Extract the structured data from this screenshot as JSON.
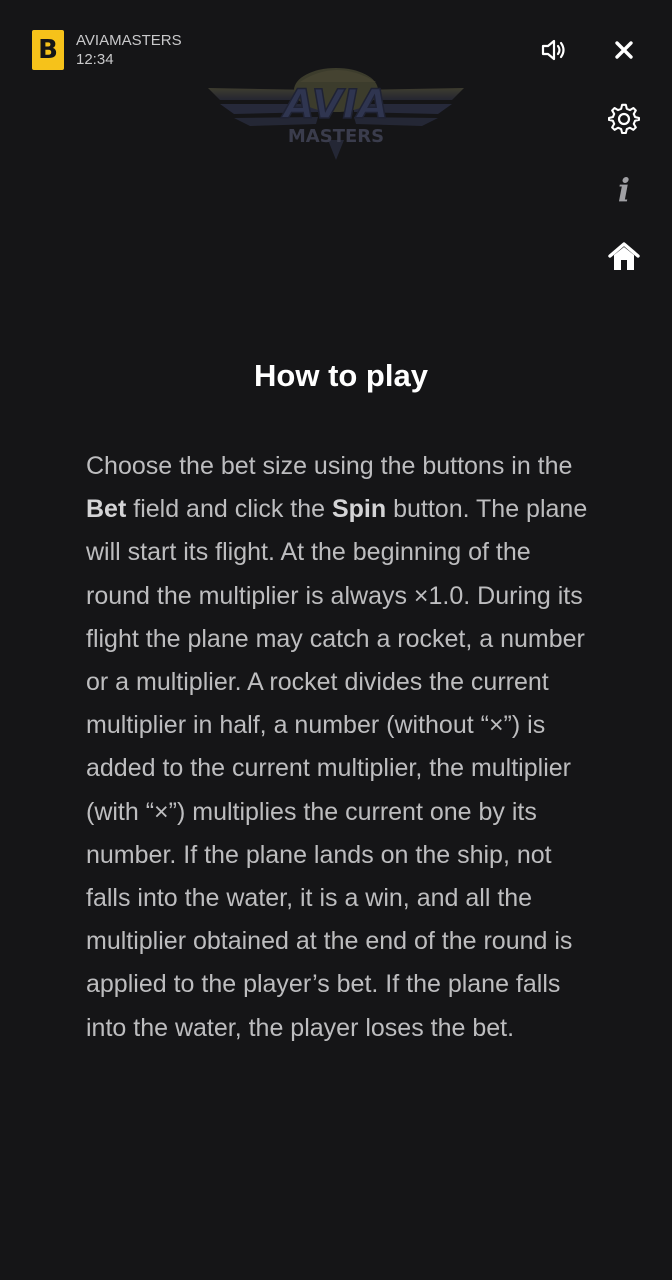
{
  "header": {
    "brand_letter": "B",
    "app_name": "AVIAMASTERS",
    "time": "12:34",
    "game_logo_text_top": "AVIA",
    "game_logo_text_bottom": "MASTERS"
  },
  "side_icons": [
    "speaker-icon",
    "close-icon",
    "gear-icon",
    "info-icon",
    "home-icon"
  ],
  "rules": {
    "title": "How to play",
    "p1": "Choose the bet size using the buttons in the ",
    "bet_label": "Bet",
    "p2": " field and click the ",
    "spin_label": "Spin",
    "p3": " button. The plane will start its flight. At the beginning of the round the multiplier is always ×1.0. During its flight the plane may catch a rocket, a number or a multiplier. A rocket divides the current multiplier in half, a number (without “×”) is added to the current multiplier, the multiplier (with “×”) multiplies the current one by its number. If the plane lands on the ship, not falls into the water, it is a win, and all the multiplier obtained at the end of the round is applied to the player’s bet. If the plane falls into the water, the player loses the bet."
  },
  "colors": {
    "background": "#151517",
    "brand_yellow": "#f6c21a",
    "text": "#bdbdbf",
    "heading": "#ffffff"
  }
}
